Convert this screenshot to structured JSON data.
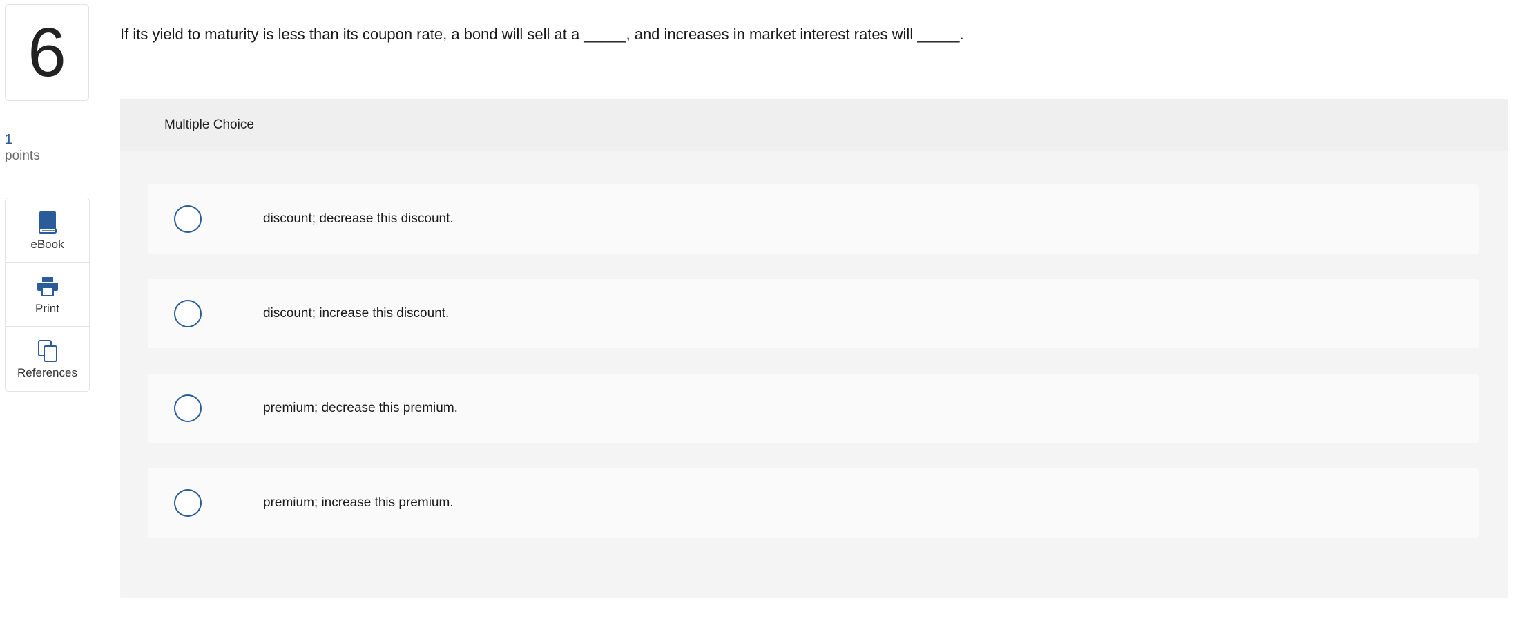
{
  "question": {
    "number": "6",
    "points_value": "1",
    "points_label": "points",
    "text": "If its yield to maturity is less than its coupon rate, a bond will sell at a _____, and increases in market interest rates will _____."
  },
  "tools": [
    {
      "label": "eBook",
      "icon": "book-icon"
    },
    {
      "label": "Print",
      "icon": "printer-icon"
    },
    {
      "label": "References",
      "icon": "copy-pages-icon"
    }
  ],
  "answer_panel": {
    "header": "Multiple Choice",
    "choices": [
      {
        "label": "discount; decrease this discount."
      },
      {
        "label": "discount; increase this discount."
      },
      {
        "label": "premium; decrease this premium."
      },
      {
        "label": "premium; increase this premium."
      }
    ]
  },
  "colors": {
    "accent": "#2a5c9a",
    "panel_bg": "#f4f4f4",
    "choice_bg": "#fafafa"
  }
}
